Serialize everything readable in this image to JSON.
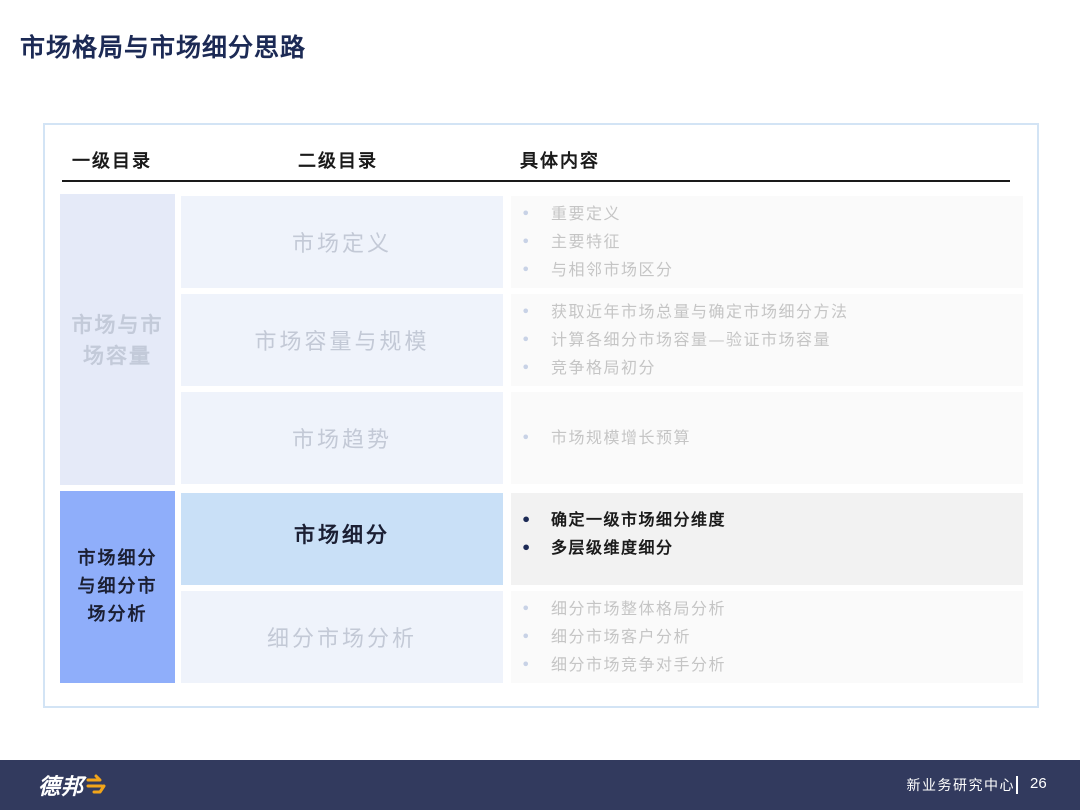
{
  "title": "市场格局与市场细分思路",
  "headers": {
    "level1": "一级目录",
    "level2": "二级目录",
    "content": "具体内容"
  },
  "groups": [
    {
      "label_line1": "市场与市",
      "label_line2": "场容量",
      "active": false,
      "items": [
        {
          "label": "市场定义",
          "active": false,
          "bullets": [
            "重要定义",
            "主要特征",
            "与相邻市场区分"
          ]
        },
        {
          "label": "市场容量与规模",
          "active": false,
          "bullets": [
            "获取近年市场总量与确定市场细分方法",
            "计算各细分市场容量—验证市场容量",
            "竞争格局初分"
          ]
        },
        {
          "label": "市场趋势",
          "active": false,
          "bullets": [
            "市场规模增长预算"
          ]
        }
      ]
    },
    {
      "label_line1": "市场细分",
      "label_line2": "与细分市",
      "label_line3": "场分析",
      "active": true,
      "items": [
        {
          "label": "市场细分",
          "active": true,
          "bullets": [
            "确定一级市场细分维度",
            "多层级维度细分"
          ]
        },
        {
          "label": "细分市场分析",
          "active": false,
          "bullets": [
            "细分市场整体格局分析",
            "细分市场客户分析",
            "细分市场竞争对手分析"
          ]
        }
      ]
    }
  ],
  "bullet_glyph": "•",
  "footer": {
    "logo_text": "德邦",
    "department": "新业务研究中心",
    "page": "26"
  },
  "colors": {
    "title": "#1c2a55",
    "footer_bg": "#323a5e",
    "active_group": "#8faefa",
    "active_row": "#c9e0f7",
    "logo_accent": "#f2a51a"
  }
}
